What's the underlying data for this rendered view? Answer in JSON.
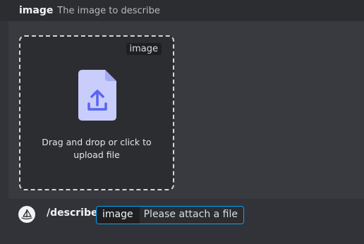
{
  "header": {
    "option_name": "image",
    "option_description": "The image to describe"
  },
  "dropzone": {
    "tag": "image",
    "instruction": "Drag and drop or click to upload file",
    "icon": "file-upload-icon"
  },
  "command": {
    "avatar_icon": "sailboat-icon",
    "name": "/describe",
    "option_key": "image",
    "option_value": "Please attach a file"
  },
  "colors": {
    "accent": "#00a8fc",
    "file_icon": "#c9cdfb",
    "upload_arrow": "#5865f2"
  }
}
